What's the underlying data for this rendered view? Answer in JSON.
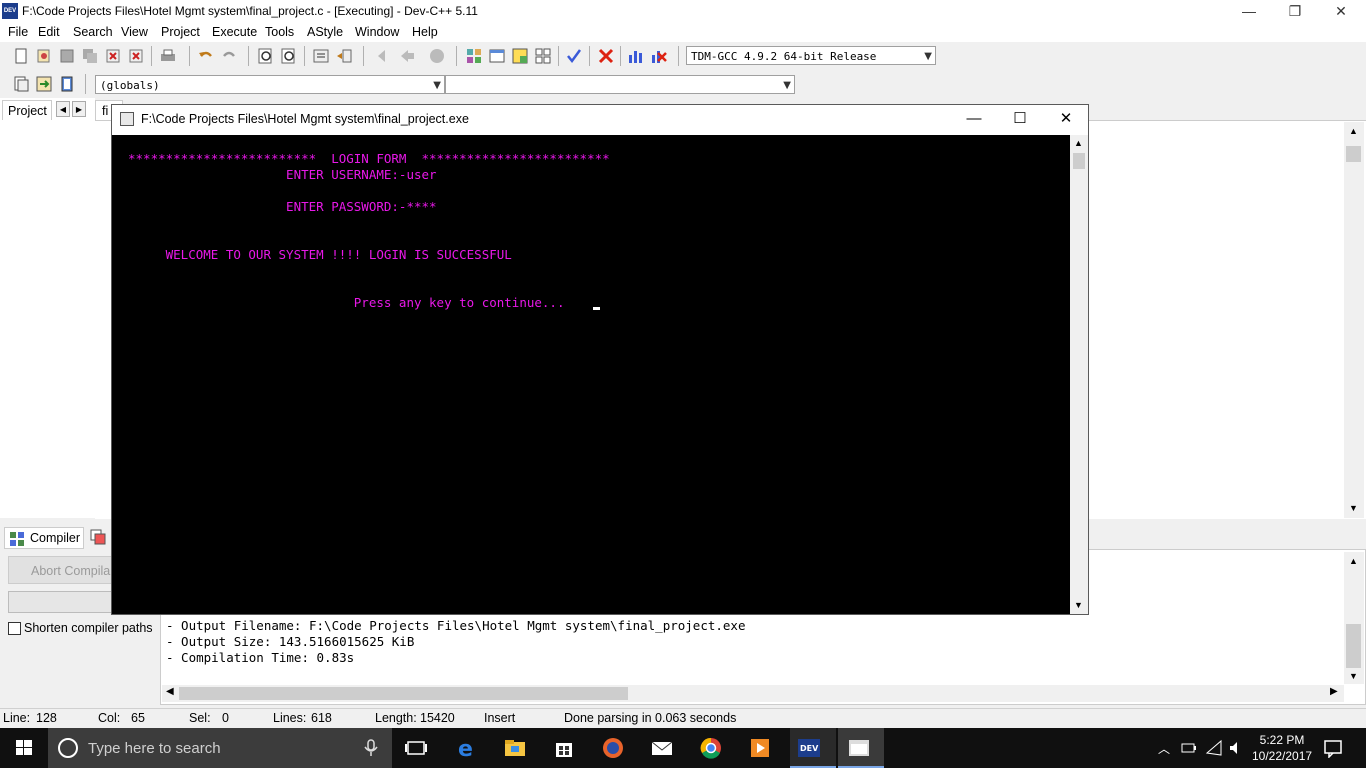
{
  "window": {
    "title": "F:\\Code Projects Files\\Hotel Mgmt system\\final_project.c - [Executing] - Dev-C++ 5.11",
    "app_icon_label": "DEV",
    "controls": {
      "minimize": "—",
      "restore": "❐",
      "close": "✕"
    }
  },
  "menu": [
    "File",
    "Edit",
    "Search",
    "View",
    "Project",
    "Execute",
    "Tools",
    "AStyle",
    "Window",
    "Help"
  ],
  "toolbar": {
    "compiler_select": "TDM-GCC 4.9.2 64-bit Release",
    "scope_select": "(globals)",
    "member_select": ""
  },
  "left_pane": {
    "tab_label": "Project",
    "nav_left": "◀",
    "nav_right": "▶"
  },
  "editor": {
    "tab_label": "fi"
  },
  "console": {
    "title": "F:\\Code Projects Files\\Hotel Mgmt system\\final_project.exe",
    "lines": [
      "*************************  LOGIN FORM  *************************",
      "                     ENTER USERNAME:-user",
      "                     ENTER PASSWORD:-****",
      "     WELCOME TO OUR SYSTEM !!!! LOGIN IS SUCCESSFUL",
      "                              Press any key to continue..."
    ],
    "text_color": "#e818e8"
  },
  "bottom_panel": {
    "compiler_tab": "Compiler",
    "abort_button": "Abort Compila",
    "shorten_label": "Shorten compiler paths",
    "log": [
      "- Output Filename: F:\\Code Projects Files\\Hotel Mgmt system\\final_project.exe",
      "- Output Size: 143.5166015625 KiB",
      "- Compilation Time: 0.83s"
    ]
  },
  "status": {
    "line_label": "Line:",
    "line": "128",
    "col_label": "Col:",
    "col": "65",
    "sel_label": "Sel:",
    "sel": "0",
    "lines_label": "Lines:",
    "lines": "618",
    "length_label": "Length:",
    "length": "15420",
    "mode": "Insert",
    "message": "Done parsing in 0.063 seconds"
  },
  "taskbar": {
    "search_placeholder": "Type here to search",
    "time": "5:22 PM",
    "date": "10/22/2017"
  }
}
